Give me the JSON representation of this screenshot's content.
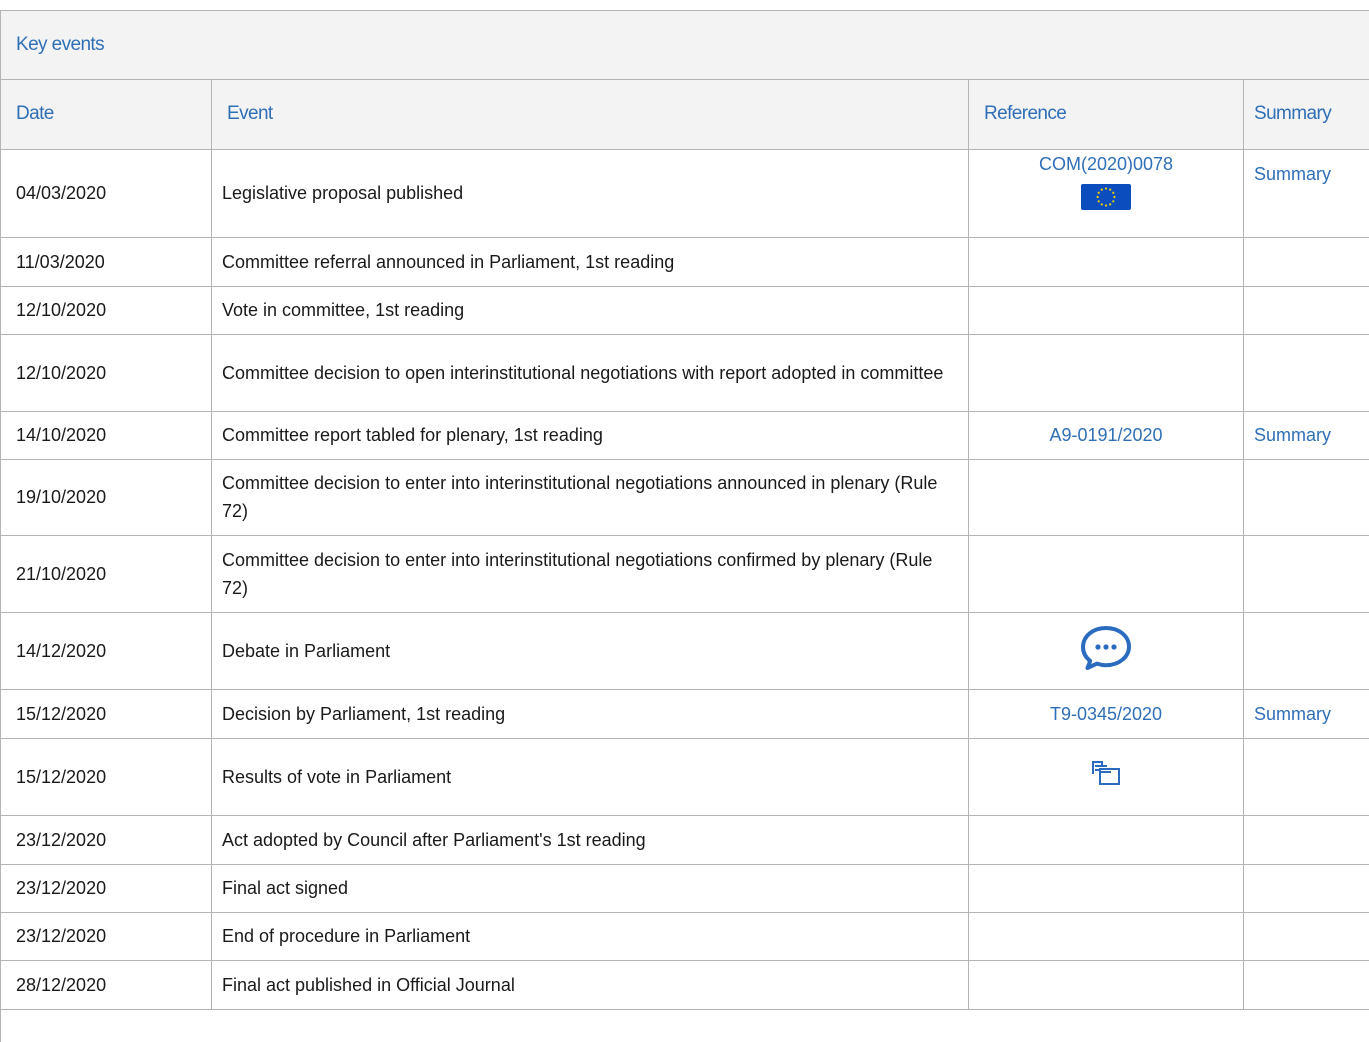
{
  "panel": {
    "title": "Key events"
  },
  "headers": {
    "date": "Date",
    "event": "Event",
    "reference": "Reference",
    "summary": "Summary"
  },
  "rows": [
    {
      "date": "04/03/2020",
      "event": "Legislative proposal published",
      "reference": "COM(2020)0078",
      "ref_icon": "eu-flag-icon",
      "summary": "Summary"
    },
    {
      "date": "11/03/2020",
      "event": "Committee referral announced in Parliament, 1st reading",
      "reference": "",
      "summary": ""
    },
    {
      "date": "12/10/2020",
      "event": "Vote in committee, 1st reading",
      "reference": "",
      "summary": ""
    },
    {
      "date": "12/10/2020",
      "event": "Committee decision to open interinstitutional negotiations with report adopted in committee",
      "reference": "",
      "summary": ""
    },
    {
      "date": "14/10/2020",
      "event": "Committee report tabled for plenary, 1st reading",
      "reference": "A9-0191/2020",
      "summary": "Summary"
    },
    {
      "date": "19/10/2020",
      "event": "Committee decision to enter into interinstitutional negotiations announced in plenary (Rule 72)",
      "reference": "",
      "summary": ""
    },
    {
      "date": "21/10/2020",
      "event": "Committee decision to enter into interinstitutional negotiations confirmed by plenary (Rule 72)",
      "reference": "",
      "summary": ""
    },
    {
      "date": "14/12/2020",
      "event": "Debate in Parliament",
      "reference": "",
      "ref_icon": "debate-speech-bubble-icon",
      "summary": ""
    },
    {
      "date": "15/12/2020",
      "event": "Decision by Parliament, 1st reading",
      "reference": "T9-0345/2020",
      "summary": "Summary"
    },
    {
      "date": "15/12/2020",
      "event": "Results of vote in Parliament",
      "reference": "",
      "ref_icon": "vote-results-icon",
      "summary": ""
    },
    {
      "date": "23/12/2020",
      "event": "Act adopted by Council after Parliament's 1st reading",
      "reference": "",
      "summary": ""
    },
    {
      "date": "23/12/2020",
      "event": "Final act signed",
      "reference": "",
      "summary": ""
    },
    {
      "date": "23/12/2020",
      "event": "End of procedure in Parliament",
      "reference": "",
      "summary": ""
    },
    {
      "date": "28/12/2020",
      "event": "Final act published in Official Journal",
      "reference": "",
      "summary": ""
    }
  ],
  "colors": {
    "link": "#2f6fb7",
    "header_bg": "#f3f3f3",
    "border": "#b4b4b4",
    "eu_flag_blue": "#0b4dbd",
    "eu_flag_stars": "#f2d200"
  }
}
